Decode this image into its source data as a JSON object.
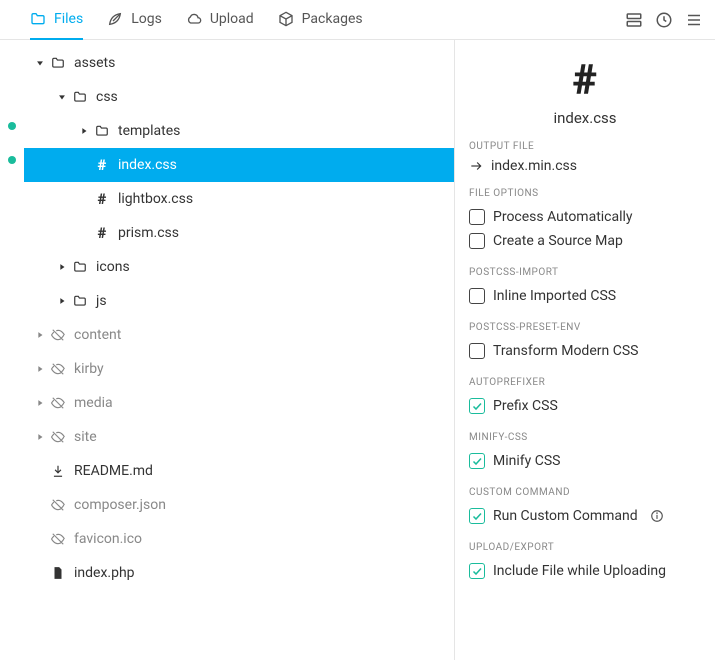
{
  "tabs": [
    {
      "label": "Files",
      "active": true
    },
    {
      "label": "Logs",
      "active": false
    },
    {
      "label": "Upload",
      "active": false
    },
    {
      "label": "Packages",
      "active": false
    }
  ],
  "tree": [
    {
      "label": "assets",
      "depth": 0,
      "icon": "folder",
      "caret": "down"
    },
    {
      "label": "css",
      "depth": 1,
      "icon": "folder",
      "caret": "down"
    },
    {
      "label": "templates",
      "depth": 2,
      "icon": "folder",
      "caret": "right"
    },
    {
      "label": "index.css",
      "depth": 2,
      "icon": "hash",
      "selected": true
    },
    {
      "label": "lightbox.css",
      "depth": 2,
      "icon": "hash"
    },
    {
      "label": "prism.css",
      "depth": 2,
      "icon": "hash"
    },
    {
      "label": "icons",
      "depth": 1,
      "icon": "folder",
      "caret": "right"
    },
    {
      "label": "js",
      "depth": 1,
      "icon": "folder",
      "caret": "right"
    },
    {
      "label": "content",
      "depth": 0,
      "icon": "hidden",
      "caret": "right",
      "faded": true
    },
    {
      "label": "kirby",
      "depth": 0,
      "icon": "hidden",
      "caret": "right",
      "faded": true
    },
    {
      "label": "media",
      "depth": 0,
      "icon": "hidden",
      "caret": "right",
      "faded": true
    },
    {
      "label": "site",
      "depth": 0,
      "icon": "hidden",
      "caret": "right",
      "faded": true
    },
    {
      "label": "README.md",
      "depth": 0,
      "icon": "download"
    },
    {
      "label": "composer.json",
      "depth": 0,
      "icon": "hidden",
      "faded": true
    },
    {
      "label": "favicon.ico",
      "depth": 0,
      "icon": "hidden",
      "faded": true
    },
    {
      "label": "index.php",
      "depth": 0,
      "icon": "file"
    }
  ],
  "panel": {
    "title": "index.css",
    "sections": {
      "output": {
        "label": "OUTPUT FILE",
        "file": "index.min.css"
      },
      "file_options": {
        "label": "FILE OPTIONS",
        "options": [
          {
            "label": "Process Automatically",
            "checked": false
          },
          {
            "label": "Create a Source Map",
            "checked": false
          }
        ]
      },
      "postcss_import": {
        "label": "POSTCSS-IMPORT",
        "options": [
          {
            "label": "Inline Imported CSS",
            "checked": false
          }
        ]
      },
      "postcss_preset_env": {
        "label": "POSTCSS-PRESET-ENV",
        "options": [
          {
            "label": "Transform Modern CSS",
            "checked": false
          }
        ]
      },
      "autoprefixer": {
        "label": "AUTOPREFIXER",
        "options": [
          {
            "label": "Prefix CSS",
            "checked": true
          }
        ]
      },
      "minify_css": {
        "label": "MINIFY-CSS",
        "options": [
          {
            "label": "Minify CSS",
            "checked": true
          }
        ]
      },
      "custom_command": {
        "label": "CUSTOM COMMAND",
        "options": [
          {
            "label": "Run Custom Command",
            "checked": true,
            "info": true
          }
        ]
      },
      "upload_export": {
        "label": "UPLOAD/EXPORT",
        "options": [
          {
            "label": "Include File while Uploading",
            "checked": true
          }
        ]
      }
    }
  }
}
